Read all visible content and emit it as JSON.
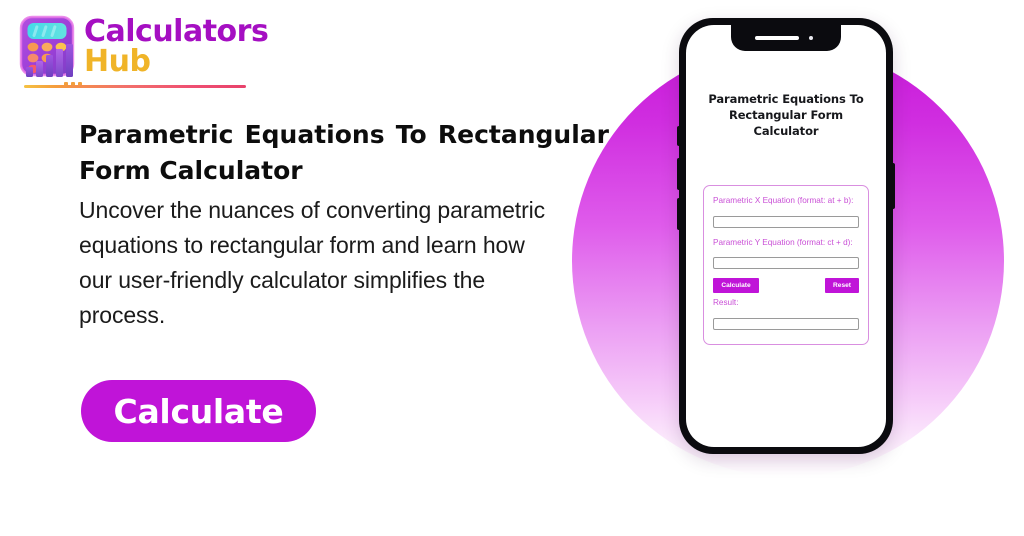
{
  "brand": {
    "name_line1": "Calculators",
    "name_line2": "Hub",
    "icon": "calculator-bar-chart-icon",
    "color_primary": "#a50fc2",
    "color_secondary": "#f0b428"
  },
  "hero": {
    "headline": "Parametric Equations To Rectangular Form Calculator",
    "description": "Uncover the nuances of converting parametric equations to rectangular form and learn how our user-friendly calculator simplifies the process.",
    "cta_label": "Calculate",
    "cta_color": "#c014d8"
  },
  "phone": {
    "screen_title": "Parametric Equations To Rectangular Form Calculator",
    "notch_icons": [
      "speaker-slot",
      "front-camera-dot"
    ],
    "calculator": {
      "fields": [
        {
          "label": "Parametric X Equation (format: at + b):",
          "value": "",
          "placeholder": ""
        },
        {
          "label": "Parametric Y Equation (format: ct + d):",
          "value": "",
          "placeholder": ""
        }
      ],
      "calculate_label": "Calculate",
      "reset_label": "Reset",
      "result_label": "Result:",
      "result_value": "",
      "accent_color": "#c014d8",
      "border_color": "#d98fe0",
      "label_color": "#c94fd6"
    }
  },
  "decor": {
    "circle_gradient_top": "#c718d8",
    "circle_gradient_bottom": "#ffffff"
  }
}
